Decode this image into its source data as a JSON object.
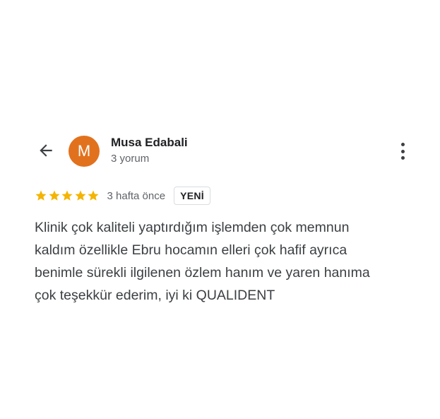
{
  "author": {
    "initial": "M",
    "name": "Musa Edabali",
    "meta": "3 yorum",
    "avatar_color": "#e2711d"
  },
  "review": {
    "rating": 5,
    "rating_max": 5,
    "star_color": "#f4b400",
    "time_ago": "3 hafta önce",
    "badge": "YENİ",
    "text_lines": [
      "Klinik çok kaliteli yaptırdığım işlemden çok memnun",
      "kaldım özellikle Ebru hocamın elleri çok hafif ayrıca",
      "benimle sürekli ilgilenen özlem hanım ve yaren hanıma",
      "çok teşekkür ederim, iyi ki QUALIDENT"
    ]
  },
  "icons": {
    "back": "arrow-left-icon",
    "more": "more-vert-icon",
    "star": "star-icon"
  }
}
